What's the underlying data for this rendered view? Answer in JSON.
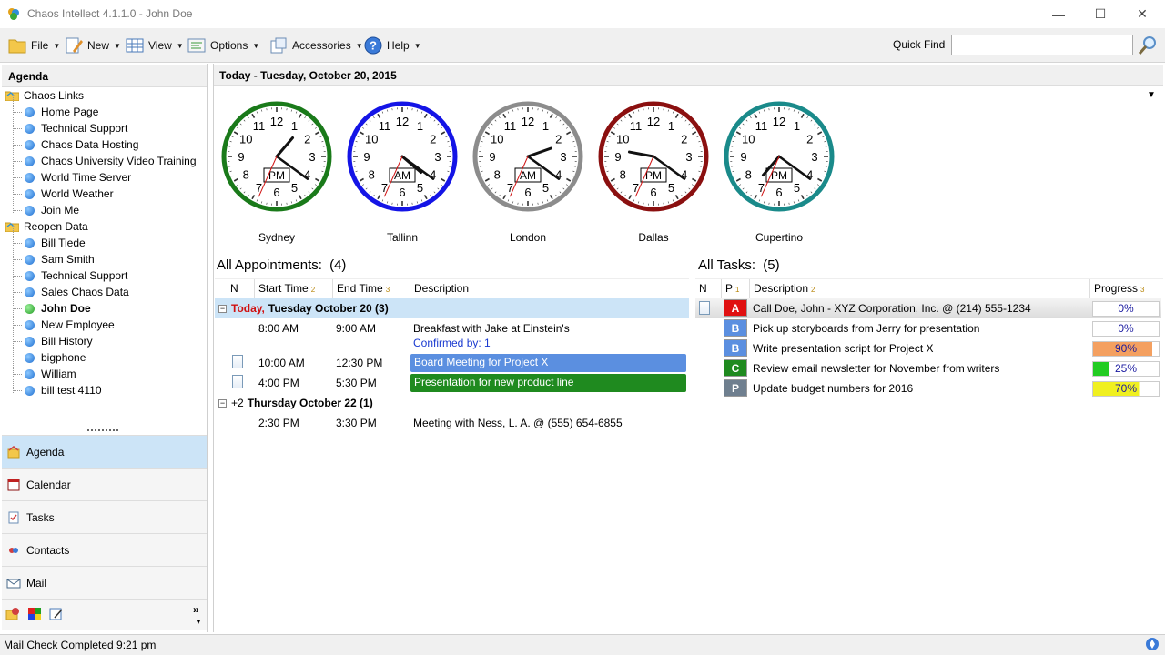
{
  "window": {
    "title": "Chaos Intellect 4.1.1.0 - John Doe"
  },
  "toolbar": {
    "file": "File",
    "new": "New",
    "view": "View",
    "options": "Options",
    "accessories": "Accessories",
    "help": "Help",
    "quick_find_label": "Quick Find",
    "quick_find_value": ""
  },
  "sidebar": {
    "header": "Agenda",
    "tree": [
      {
        "label": "Chaos Links",
        "kind": "folder"
      },
      {
        "label": "Home Page",
        "kind": "item"
      },
      {
        "label": "Technical Support",
        "kind": "item"
      },
      {
        "label": "Chaos Data Hosting",
        "kind": "item"
      },
      {
        "label": "Chaos University Video Training",
        "kind": "item"
      },
      {
        "label": "World Time Server",
        "kind": "item"
      },
      {
        "label": "World Weather",
        "kind": "item"
      },
      {
        "label": "Join Me",
        "kind": "item"
      },
      {
        "label": "Reopen Data",
        "kind": "folder"
      },
      {
        "label": "Bill Tiede",
        "kind": "item"
      },
      {
        "label": "Sam Smith",
        "kind": "item"
      },
      {
        "label": "Technical Support",
        "kind": "item"
      },
      {
        "label": "Sales Chaos Data",
        "kind": "item"
      },
      {
        "label": "John Doe",
        "kind": "item-active"
      },
      {
        "label": "New Employee",
        "kind": "item"
      },
      {
        "label": "Bill History",
        "kind": "item"
      },
      {
        "label": "bigphone",
        "kind": "item"
      },
      {
        "label": "William",
        "kind": "item"
      },
      {
        "label": "bill test 4110",
        "kind": "item"
      }
    ],
    "nav": [
      {
        "label": "Agenda",
        "icon": "agenda-icon",
        "active": true
      },
      {
        "label": "Calendar",
        "icon": "calendar-icon"
      },
      {
        "label": "Tasks",
        "icon": "tasks-icon"
      },
      {
        "label": "Contacts",
        "icon": "contacts-icon"
      },
      {
        "label": "Mail",
        "icon": "mail-icon"
      }
    ]
  },
  "main": {
    "today_header": "Today - Tuesday, October 20, 2015",
    "clocks": [
      {
        "city": "Sydney",
        "ampm": "PM",
        "color": "#1a7a1a",
        "hour": 1,
        "minute": 21,
        "second": 34
      },
      {
        "city": "Tallinn",
        "ampm": "AM",
        "color": "#1414e6",
        "hour": 4,
        "minute": 21,
        "second": 34
      },
      {
        "city": "London",
        "ampm": "AM",
        "color": "#8c8c8c",
        "hour": 2,
        "minute": 21,
        "second": 34
      },
      {
        "city": "Dallas",
        "ampm": "PM",
        "color": "#8b1010",
        "hour": 9,
        "minute": 21,
        "second": 34
      },
      {
        "city": "Cupertino",
        "ampm": "PM",
        "color": "#1a8a8a",
        "hour": 7,
        "minute": 21,
        "second": 34
      }
    ],
    "appointments": {
      "title": "All Appointments:",
      "count": "(4)",
      "columns": {
        "n": "N",
        "start": "Start Time",
        "end": "End Time",
        "desc": "Description"
      },
      "sort_badges": {
        "start": "2",
        "end": "3"
      },
      "groups": [
        {
          "prefix": "Today,",
          "label": "Tuesday October 20 (3)"
        },
        {
          "prefix": "+2",
          "label": "Thursday October 22 (1)"
        }
      ],
      "rows": [
        {
          "start": "8:00 AM",
          "end": "9:00 AM",
          "desc": "Breakfast with Jake at Einstein's",
          "sub": "Confirmed by: 1"
        },
        {
          "start": "10:00 AM",
          "end": "12:30 PM",
          "desc": "Board Meeting for Project X",
          "bar_color": "#5b8fe0"
        },
        {
          "start": "4:00 PM",
          "end": "5:30 PM",
          "desc": "Presentation for new product line",
          "bar_color": "#1f8a1f"
        },
        {
          "start": "2:30 PM",
          "end": "3:30 PM",
          "desc": "Meeting with Ness, L. A. @ (555) 654-6855"
        }
      ]
    },
    "tasks": {
      "title": "All Tasks:",
      "count": "(5)",
      "columns": {
        "n": "N",
        "p": "P",
        "desc": "Description",
        "progress": "Progress"
      },
      "sort_badges": {
        "p": "1",
        "desc": "2",
        "progress": "3"
      },
      "rows": [
        {
          "priority": "A",
          "color": "#e01010",
          "desc": "Call Doe, John - XYZ Corporation, Inc. @ (214) 555-1234",
          "progress": "0%",
          "progress_value": 0,
          "bar_color": "#ffffff"
        },
        {
          "priority": "B",
          "color": "#5b8fe0",
          "desc": "Pick up storyboards from Jerry for presentation",
          "progress": "0%",
          "progress_value": 0,
          "bar_color": "#ffffff"
        },
        {
          "priority": "B",
          "color": "#5b8fe0",
          "desc": "Write presentation script for Project X",
          "progress": "90%",
          "progress_value": 90,
          "bar_color": "#f4a060"
        },
        {
          "priority": "C",
          "color": "#1f8a1f",
          "desc": "Review email newsletter for November from writers",
          "progress": "25%",
          "progress_value": 25,
          "bar_color": "#22cc22"
        },
        {
          "priority": "P",
          "color": "#6f7f8f",
          "desc": "Update budget numbers for 2016",
          "progress": "70%",
          "progress_value": 70,
          "bar_color": "#f0f020"
        }
      ]
    }
  },
  "status": {
    "text": "Mail Check Completed 9:21 pm"
  }
}
